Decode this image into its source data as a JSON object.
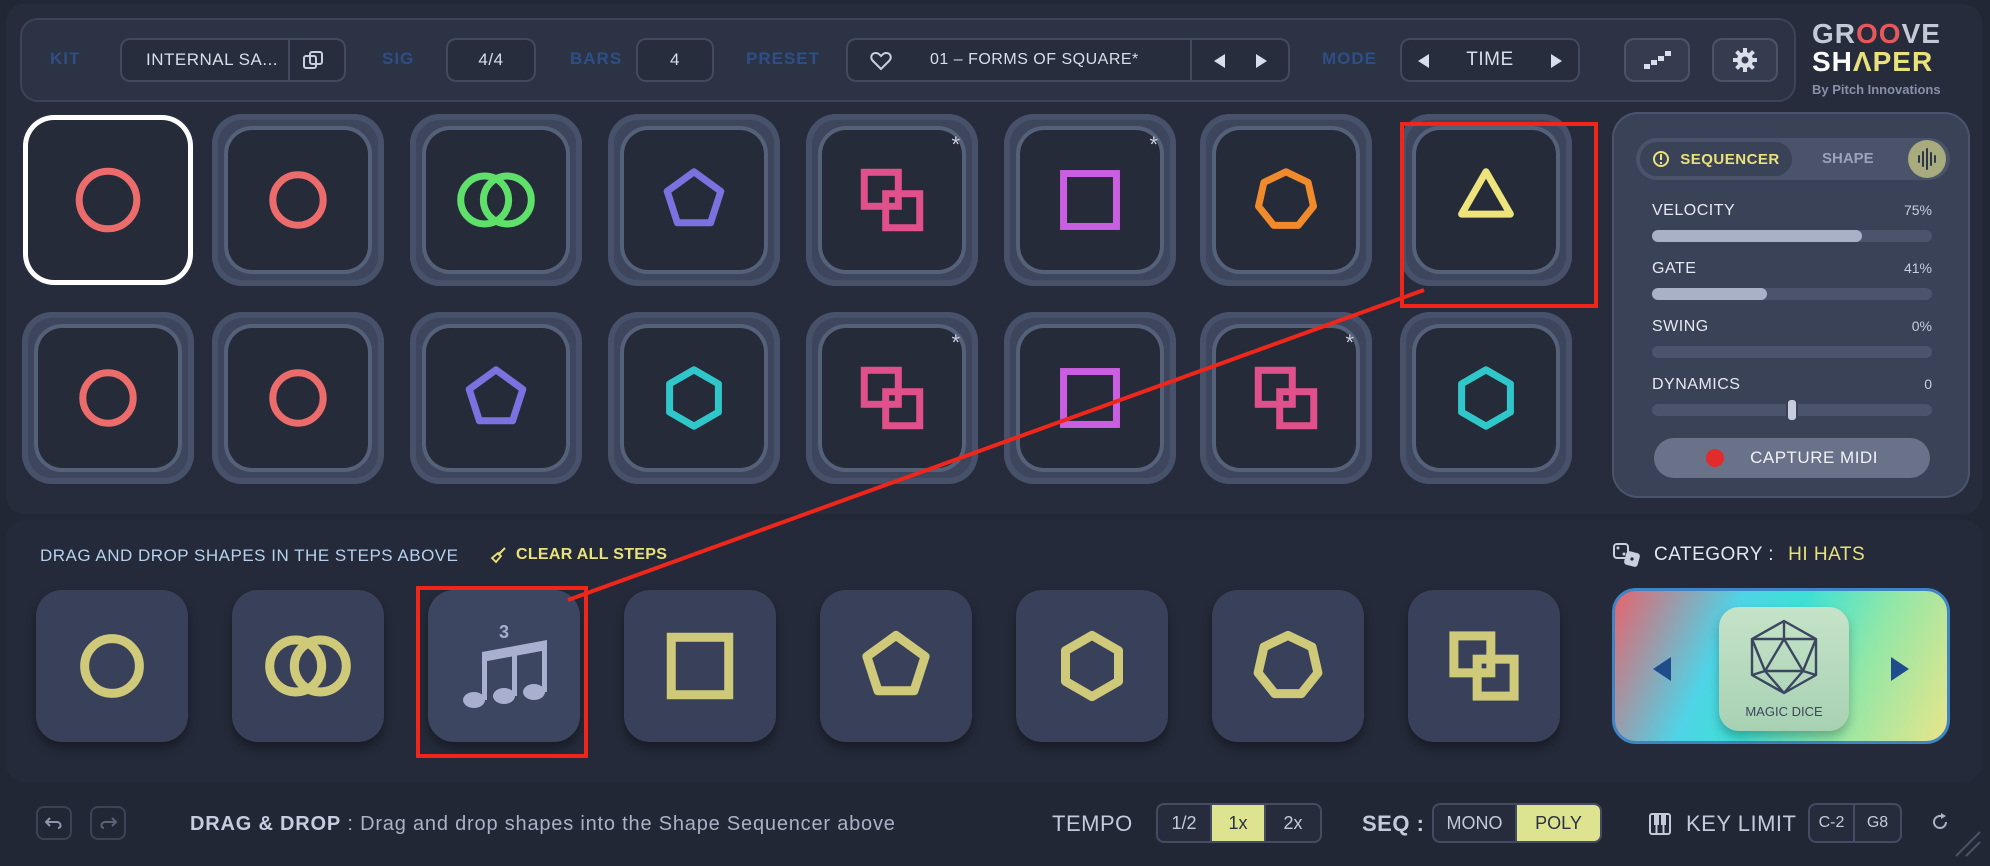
{
  "topbar": {
    "kit_label": "KIT",
    "kit_value": "INTERNAL SA...",
    "sig_label": "SIG",
    "sig_value": "4/4",
    "bars_label": "BARS",
    "bars_value": "4",
    "preset_label": "PRESET",
    "preset_value": "01 – FORMS OF SQUARE*",
    "mode_label": "MODE",
    "mode_value": "TIME"
  },
  "logo": {
    "line1_a": "GR",
    "line1_b": "OO",
    "line1_c": "VE",
    "line2_a": "SH",
    "line2_b": "Λ",
    "line2_c": "PER",
    "byline": "By Pitch Innovations"
  },
  "steps": {
    "row1": [
      {
        "shape": "circle",
        "color": "#ec6c6c",
        "star": ""
      },
      {
        "shape": "circle",
        "color": "#ec6c6c",
        "star": ""
      },
      {
        "shape": "double-circle",
        "color": "#5ee06a",
        "star": ""
      },
      {
        "shape": "pentagon",
        "color": "#7b72e0",
        "star": ""
      },
      {
        "shape": "double-square",
        "color": "#e0508a",
        "star": "*"
      },
      {
        "shape": "square",
        "color": "#c95fe0",
        "star": "*"
      },
      {
        "shape": "heptagon",
        "color": "#f08a2a",
        "star": ""
      },
      {
        "shape": "triangle",
        "color": "#ede57c",
        "star": ""
      }
    ],
    "row2": [
      {
        "shape": "circle",
        "color": "#ec6c6c",
        "star": ""
      },
      {
        "shape": "circle",
        "color": "#ec6c6c",
        "star": ""
      },
      {
        "shape": "pentagon",
        "color": "#7b72e0",
        "star": ""
      },
      {
        "shape": "hexagon",
        "color": "#2fc7c9",
        "star": ""
      },
      {
        "shape": "double-square",
        "color": "#e0508a",
        "star": "*"
      },
      {
        "shape": "square",
        "color": "#c95fe0",
        "star": ""
      },
      {
        "shape": "double-square",
        "color": "#e0508a",
        "star": "*"
      },
      {
        "shape": "hexagon",
        "color": "#2fc7c9",
        "star": ""
      }
    ]
  },
  "panel": {
    "tab_sequencer": "SEQUENCER",
    "tab_shape": "SHAPE",
    "velocity_label": "VELOCITY",
    "velocity_value": "75%",
    "velocity_level": 0.75,
    "gate_label": "GATE",
    "gate_value": "41%",
    "gate_level": 0.41,
    "swing_label": "SWING",
    "swing_value": "0%",
    "swing_level": 0,
    "dynamics_label": "DYNAMICS",
    "dynamics_value": "0",
    "capture_label": "CAPTURE MIDI"
  },
  "lower": {
    "hint": "DRAG AND DROP SHAPES IN THE STEPS ABOVE",
    "clear_all": "CLEAR ALL STEPS",
    "category_label": "CATEGORY :",
    "category_value": "HI HATS",
    "magic_dice": "MAGIC DICE",
    "triplet_number": "3",
    "shapes_color": "#cfc97a"
  },
  "status": {
    "dd_bold": "DRAG & DROP",
    "dd_text": " : Drag and drop shapes into the Shape Sequencer above",
    "tempo_label": "TEMPO",
    "tempo_options": [
      "1/2",
      "1x",
      "2x"
    ],
    "tempo_selected": "1x",
    "seq_label": "SEQ :",
    "seq_options": [
      "MONO",
      "POLY"
    ],
    "seq_selected": "POLY",
    "key_limit_label": "KEY LIMIT",
    "key_low": "C-2",
    "key_high": "G8"
  },
  "colors": {
    "accent_yellow": "#e9e17a",
    "annotation_red": "#f0261a"
  }
}
